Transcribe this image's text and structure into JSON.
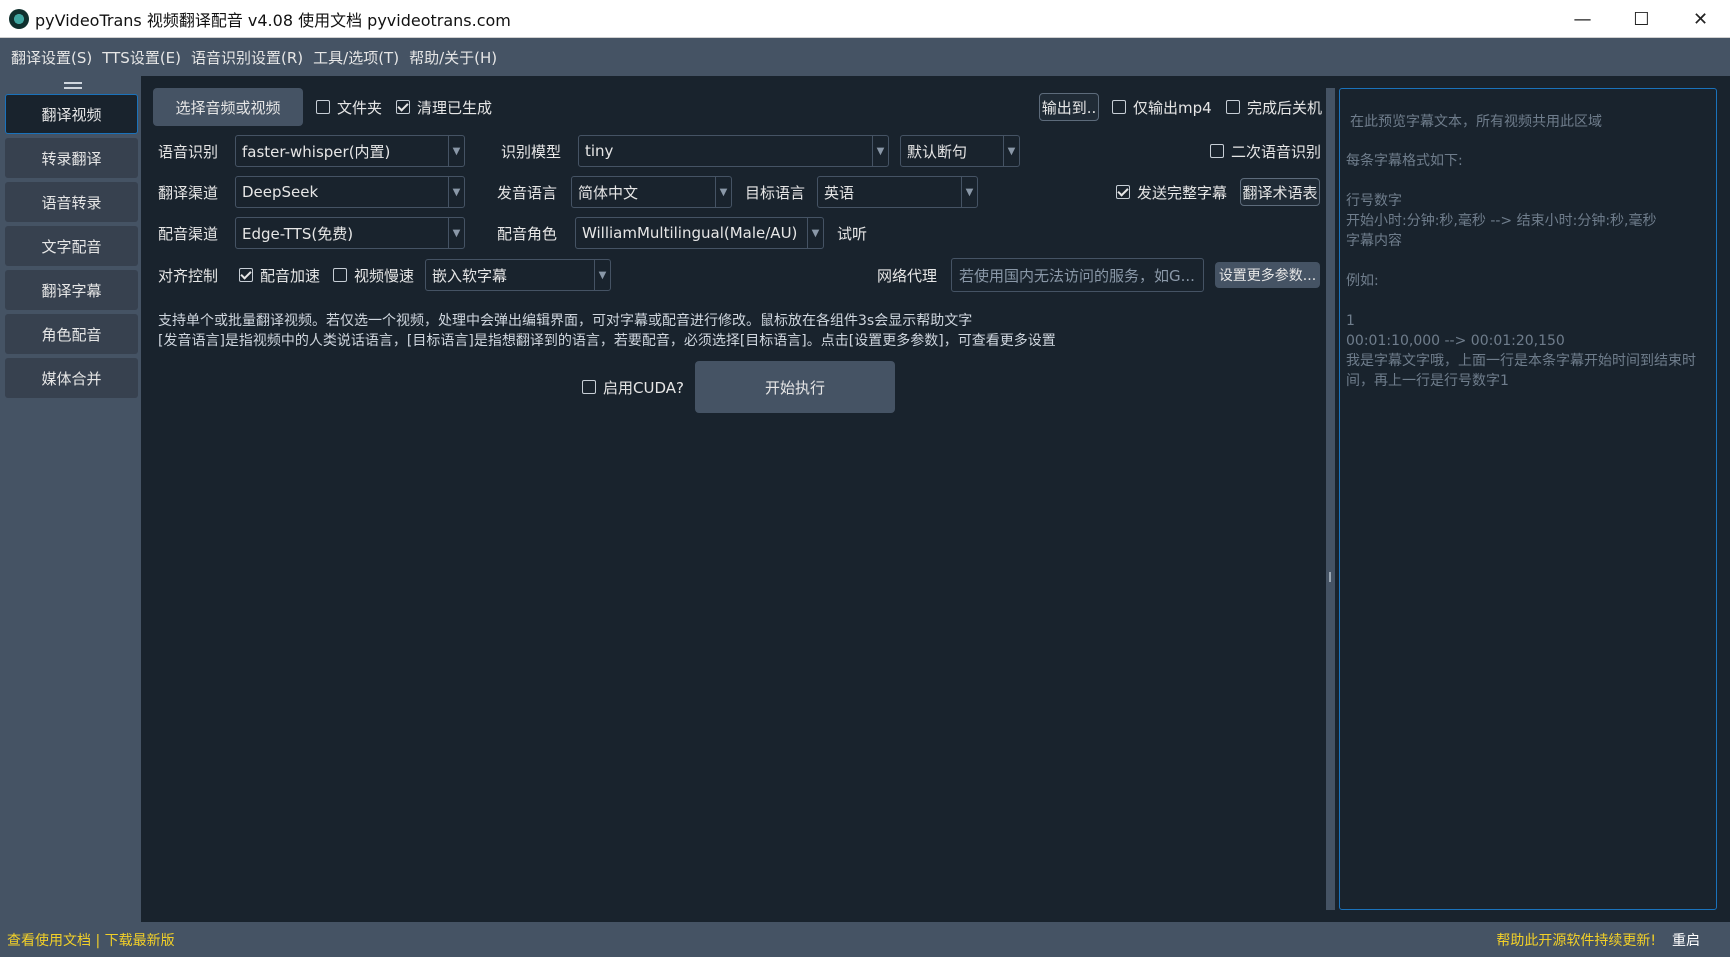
{
  "window": {
    "title": "pyVideoTrans 视频翻译配音 v4.08 使用文档 pyvideotrans.com",
    "minimize": "—",
    "maximize": "☐",
    "close": "✕"
  },
  "menu": [
    "翻译设置(S)",
    "TTS设置(E)",
    "语音识别设置(R)",
    "工具/选项(T)",
    "帮助/关于(H)"
  ],
  "sidebar": {
    "items": [
      {
        "label": "翻译视频",
        "active": true
      },
      {
        "label": "转录翻译"
      },
      {
        "label": "语音转录"
      },
      {
        "label": "文字配音"
      },
      {
        "label": "翻译字幕"
      },
      {
        "label": "角色配音"
      },
      {
        "label": "媒体合并"
      }
    ]
  },
  "main": {
    "select_file": "选择音频或视频",
    "folder": {
      "label": "文件夹",
      "checked": false
    },
    "clear_generated": {
      "label": "清理已生成",
      "checked": true
    },
    "output_to": "输出到..",
    "only_mp4": {
      "label": "仅输出mp4",
      "checked": false
    },
    "shutdown": {
      "label": "完成后关机",
      "checked": false
    },
    "asr_label": "语音识别",
    "asr_value": "faster-whisper(内置)",
    "model_label": "识别模型",
    "model_value": "tiny",
    "split_value": "默认断句",
    "second_asr": {
      "label": "二次语音识别",
      "checked": false
    },
    "trans_label": "翻译渠道",
    "trans_value": "DeepSeek",
    "src_lang_label": "发音语言",
    "src_lang_value": "简体中文",
    "target_lang_label": "目标语言",
    "target_lang_value": "英语",
    "send_full": {
      "label": "发送完整字幕",
      "checked": true
    },
    "glossary": "翻译术语表",
    "tts_label": "配音渠道",
    "tts_value": "Edge-TTS(免费)",
    "role_label": "配音角色",
    "role_value": "WilliamMultilingual(Male/AU)",
    "listen": "试听",
    "align_label": "对齐控制",
    "voice_speed": {
      "label": "配音加速",
      "checked": true
    },
    "video_slow": {
      "label": "视频慢速",
      "checked": false
    },
    "subtitle_mode": "嵌入软字幕",
    "proxy_label": "网络代理",
    "proxy_placeholder": "若使用国内无法访问的服务，如G...",
    "more_params": "设置更多参数...",
    "help1": "支持单个或批量翻译视频。若仅选一个视频，处理中会弹出编辑界面，可对字幕或配音进行修改。鼠标放在各组件3s会显示帮助文字",
    "help2": "[发音语言]是指视频中的人类说话语言，[目标语言]是指想翻译到的语言，若要配音，必须选择[目标语言]。点击[设置更多参数]，可查看更多设置",
    "cuda": {
      "label": "启用CUDA?",
      "checked": false
    },
    "start": "开始执行"
  },
  "preview": {
    "placeholder": "在此预览字幕文本，所有视频共用此区域",
    "body": "每条字幕格式如下:\n\n行号数字\n开始小时:分钟:秒,毫秒 --> 结束小时:分钟:秒,毫秒\n字幕内容\n\n例如:\n\n1\n00:01:10,000 --> 00:01:20,150\n我是字幕文字哦，上面一行是本条字幕开始时间到结束时间，再上一行是行号数字1"
  },
  "status": {
    "docs": "查看使用文档",
    "sep": " | ",
    "download": "下载最新版",
    "support": "帮助此开源软件持续更新!",
    "restart": "重启"
  }
}
